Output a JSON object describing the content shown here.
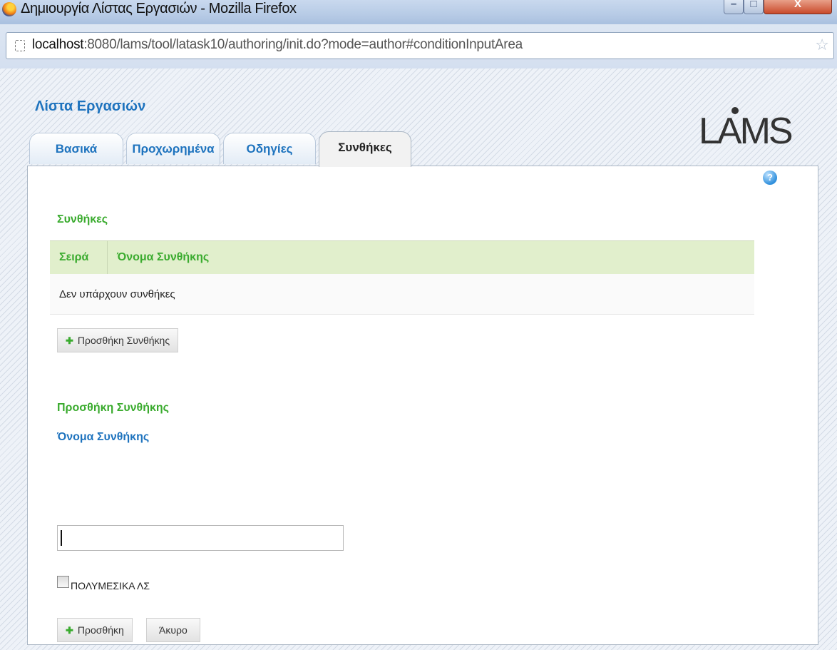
{
  "window": {
    "title": "Δημιουργία Λίστας Εργασιών - Mozilla Firefox",
    "minimize_glyph": "–",
    "maximize_glyph": "□",
    "close_glyph": "X"
  },
  "address_bar": {
    "host": "localhost",
    "path": ":8080/lams/tool/latask10/authoring/init.do?mode=author#conditionInputArea"
  },
  "header": {
    "tool_title": "Λίστα Εργασιών",
    "logo_text": "LAMS"
  },
  "tabs": [
    {
      "label": "Βασικά",
      "active": false
    },
    {
      "label": "Προχωρημένα",
      "active": false
    },
    {
      "label": "Οδηγίες",
      "active": false
    },
    {
      "label": "Συνθήκες",
      "active": true
    }
  ],
  "help": {
    "glyph": "?"
  },
  "conditions_section": {
    "heading": "Συνθήκες",
    "table": {
      "columns": [
        "Σειρά",
        "Όνομα Συνθήκης"
      ],
      "empty_message": "Δεν υπάρχουν συνθήκες"
    },
    "add_button_label": "Προσθήκη Συνθήκης"
  },
  "add_condition_form": {
    "heading": "Προσθήκη Συνθήκης",
    "name_label": "Όνομα Συνθήκης",
    "name_value": "",
    "task_checkbox": {
      "label": "ΠΟΛΥΜΕΣΙΚΑ ΛΣ",
      "checked": false
    },
    "submit_label": "Προσθήκη",
    "cancel_label": "Άκυρο"
  },
  "icons": {
    "plus_glyph": "✚",
    "star_glyph": "☆"
  },
  "colors": {
    "link_blue": "#1e73be",
    "heading_green": "#3aab2e",
    "table_header_bg": "#e1efcc"
  }
}
